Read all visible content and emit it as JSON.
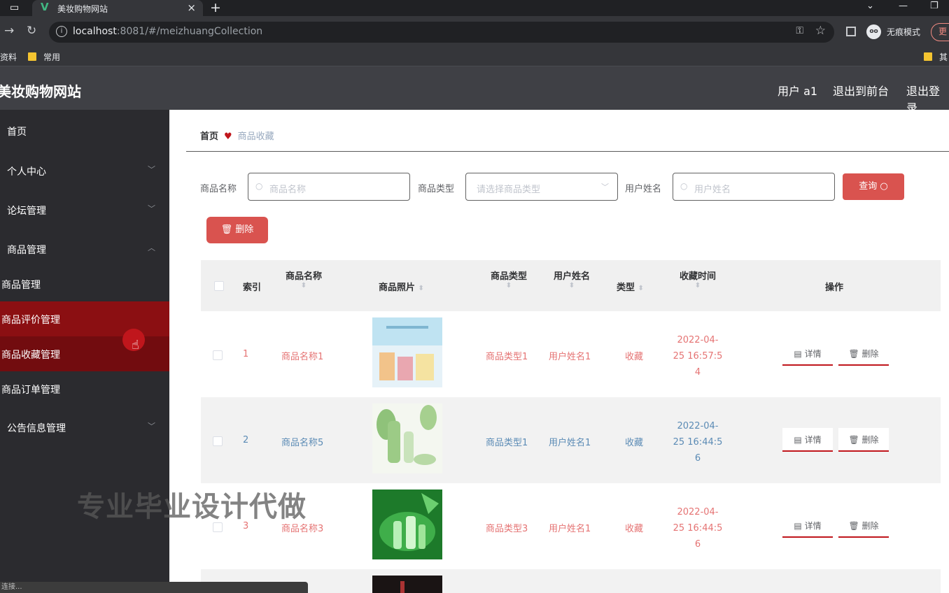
{
  "browser": {
    "tab_title": "美妆购物网站",
    "tab_logo": "V",
    "url_host": "localhost",
    "url_rest": ":8081/#/meizhuangCollection",
    "incognito_label": "无痕模式",
    "update_label": "更",
    "bookmarks": [
      "资料",
      "常用",
      "其"
    ]
  },
  "header": {
    "site_title": "美妆购物网站",
    "user_label": "用户 a1",
    "back_front_label": "退出到前台",
    "logout_label": "退出登录"
  },
  "sidebar": {
    "items": [
      {
        "label": "首页"
      },
      {
        "label": "个人中心"
      },
      {
        "label": "论坛管理"
      },
      {
        "label": "商品管理"
      }
    ],
    "sub_items": [
      {
        "label": "商品管理"
      },
      {
        "label": "商品评价管理"
      },
      {
        "label": "商品收藏管理"
      },
      {
        "label": "商品订单管理"
      }
    ],
    "last_item": {
      "label": "公告信息管理"
    }
  },
  "breadcrumb": {
    "home": "首页",
    "current": "商品收藏"
  },
  "filters": {
    "name_label": "商品名称",
    "name_placeholder": "商品名称",
    "type_label": "商品类型",
    "type_placeholder": "请选择商品类型",
    "user_label": "用户姓名",
    "user_placeholder": "用户姓名",
    "query_label": "查询",
    "delete_label": "删除"
  },
  "table": {
    "headers": {
      "index": "索引",
      "name": "商品名称",
      "photo": "商品照片",
      "type": "商品类型",
      "user": "用户姓名",
      "kind": "类型",
      "time": "收藏时间",
      "ops": "操作"
    },
    "rows": [
      {
        "index": "1",
        "name": "商品名称1",
        "type": "商品类型1",
        "user": "用户姓名1",
        "kind": "收藏",
        "time1": "2022-04-",
        "time2": "25 16:57:5",
        "time3": "4",
        "detail": "详情",
        "delete": "删除"
      },
      {
        "index": "2",
        "name": "商品名称5",
        "type": "商品类型1",
        "user": "用户姓名1",
        "kind": "收藏",
        "time1": "2022-04-",
        "time2": "25 16:44:5",
        "time3": "6",
        "detail": "详情",
        "delete": "删除"
      },
      {
        "index": "3",
        "name": "商品名称3",
        "type": "商品类型3",
        "user": "用户姓名1",
        "kind": "收藏",
        "time1": "2022-04-",
        "time2": "25 16:44:5",
        "time3": "6",
        "detail": "详情",
        "delete": "删除"
      }
    ]
  },
  "watermark": "专业毕业设计代做",
  "status": "连接...",
  "colors": {
    "accent": "#c0161c",
    "button": "#d9534f",
    "header_bg": "#3f4045",
    "sidebar_bg": "#2b2b2f"
  }
}
